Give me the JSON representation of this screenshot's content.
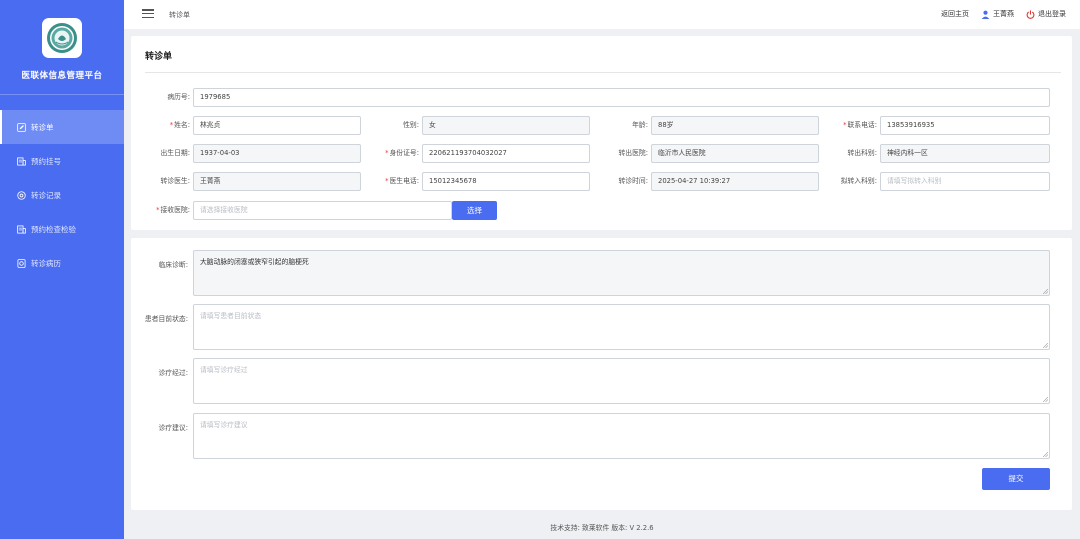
{
  "sidebar": {
    "platform_title": "医联体信息管理平台",
    "items": [
      {
        "label": "转诊单",
        "icon": "edit-icon",
        "active": true
      },
      {
        "label": "预约挂号",
        "icon": "register-icon",
        "active": false
      },
      {
        "label": "转诊记录",
        "icon": "record-icon",
        "active": false
      },
      {
        "label": "预约检查检验",
        "icon": "exam-icon",
        "active": false
      },
      {
        "label": "转诊病历",
        "icon": "case-icon",
        "active": false
      }
    ]
  },
  "topbar": {
    "breadcrumb": "转诊单",
    "home_link": "返回主页",
    "user_name": "王菁燕",
    "logout_link": "退出登录"
  },
  "form": {
    "title": "转诊单",
    "medical_record_label": "病历号:",
    "medical_record_value": "1979685",
    "name_label": "姓名:",
    "name_value": "林兆贞",
    "gender_label": "性别:",
    "gender_value": "女",
    "age_label": "年龄:",
    "age_value": "88岁",
    "phone_label": "联系电话:",
    "phone_value": "13853916935",
    "birth_label": "出生日期:",
    "birth_value": "1937-04-03",
    "id_label": "身份证号:",
    "id_value": "220621193704032027",
    "from_hospital_label": "转出医院:",
    "from_hospital_value": "临沂市人民医院",
    "from_dept_label": "转出科别:",
    "from_dept_value": "神经内科一区",
    "doctor_label": "转诊医生:",
    "doctor_value": "王菁燕",
    "doctor_phone_label": "医生电话:",
    "doctor_phone_value": "15012345678",
    "referral_time_label": "转诊时间:",
    "referral_time_value": "2025-04-27 10:39:27",
    "target_dept_label": "拟转入科别:",
    "target_dept_placeholder": "请填写拟转入科别",
    "target_hospital_label": "接收医院:",
    "target_hospital_placeholder": "请选择接收医院",
    "select_button": "选择"
  },
  "clinical": {
    "diagnosis_label": "临床诊断:",
    "diagnosis_value": "大脑动脉的闭塞或狭窄引起的脑梗死",
    "status_label": "患者目前状态:",
    "status_placeholder": "请填写患者目前状态",
    "process_label": "诊疗经过:",
    "process_placeholder": "请填写诊疗经过",
    "advice_label": "诊疗建议:",
    "advice_placeholder": "请填写诊疗建议",
    "submit_button": "提交"
  },
  "footer": {
    "text": "技术支持: 致莱软件  版本: V 2.2.6"
  },
  "colors": {
    "sidebar": "#4a6cf0",
    "accent": "#4a6cf0",
    "required": "#e33333",
    "logout": "#e33333"
  }
}
